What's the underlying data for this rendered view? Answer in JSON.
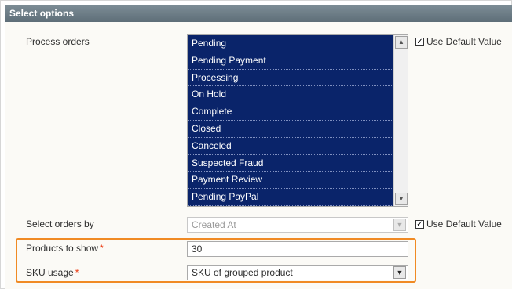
{
  "section": {
    "title": "Select options"
  },
  "process_orders": {
    "label": "Process orders",
    "options": [
      "Pending",
      "Pending Payment",
      "Processing",
      "On Hold",
      "Complete",
      "Closed",
      "Canceled",
      "Suspected Fraud",
      "Payment Review",
      "Pending PayPal"
    ],
    "use_default_label": "Use Default Value",
    "use_default_checked": true
  },
  "select_orders_by": {
    "label": "Select orders by",
    "value": "Created At",
    "use_default_label": "Use Default Value",
    "use_default_checked": true
  },
  "products_to_show": {
    "label": "Products to show",
    "required_mark": "*",
    "value": "30"
  },
  "sku_usage": {
    "label": "SKU usage",
    "required_mark": "*",
    "value": "SKU of grouped product"
  },
  "colors": {
    "header": "#6f7f88",
    "selected_item_bg": "#0a246a",
    "highlight_border": "#f08a24",
    "required": "#eb340a"
  }
}
